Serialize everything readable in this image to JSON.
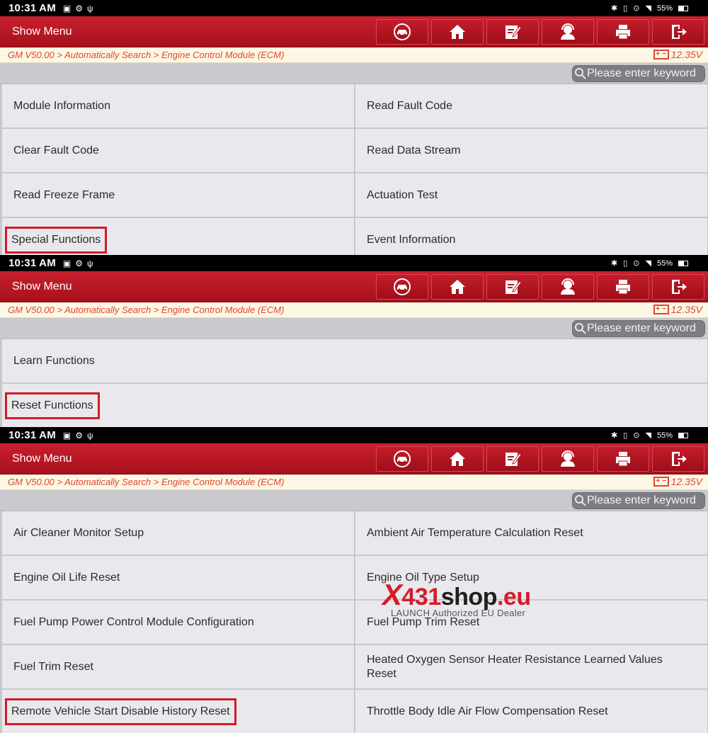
{
  "status": {
    "time": "10:31 AM",
    "battery": "55%"
  },
  "header": {
    "title": "Show Menu"
  },
  "toolbar": {
    "buttons": [
      "vehicle-icon",
      "home-icon",
      "edit-report-icon",
      "support-icon",
      "print-icon",
      "exit-icon"
    ]
  },
  "breadcrumb": {
    "path": "GM V50.00 > Automatically Search > Engine Control Module (ECM)",
    "voltage": "12.35V"
  },
  "search": {
    "placeholder": "Please enter keyword"
  },
  "screen1": {
    "items": [
      "Module Information",
      "Read Fault Code",
      "Clear Fault Code",
      "Read Data Stream",
      "Read Freeze Frame",
      "Actuation Test",
      "Special Functions",
      "Event Information"
    ],
    "highlighted": "Special Functions"
  },
  "screen2": {
    "items": [
      "Learn Functions",
      "Reset Functions"
    ],
    "highlighted": "Reset Functions"
  },
  "screen3": {
    "items": [
      "Air Cleaner Monitor Setup",
      "Ambient Air Temperature Calculation Reset",
      "Engine Oil Life Reset",
      "Engine Oil Type Setup",
      "Fuel Pump Power Control Module Configuration",
      "Fuel Pump Trim Reset",
      "Fuel Trim Reset",
      "Heated Oxygen Sensor Heater Resistance Learned Values Reset",
      "Remote Vehicle Start Disable History Reset",
      "Throttle Body Idle Air Flow Compensation Reset"
    ],
    "highlighted": "Remote Vehicle Start Disable History Reset"
  },
  "watermark": {
    "x": "X",
    "num": "431",
    "shop": "shop",
    "eu": ".eu",
    "tagline": "LAUNCH Authorized EU Dealer"
  },
  "colors": {
    "header_red": "#b5141f",
    "highlight_red": "#d21a28",
    "breadcrumb_text": "#e0462f"
  }
}
